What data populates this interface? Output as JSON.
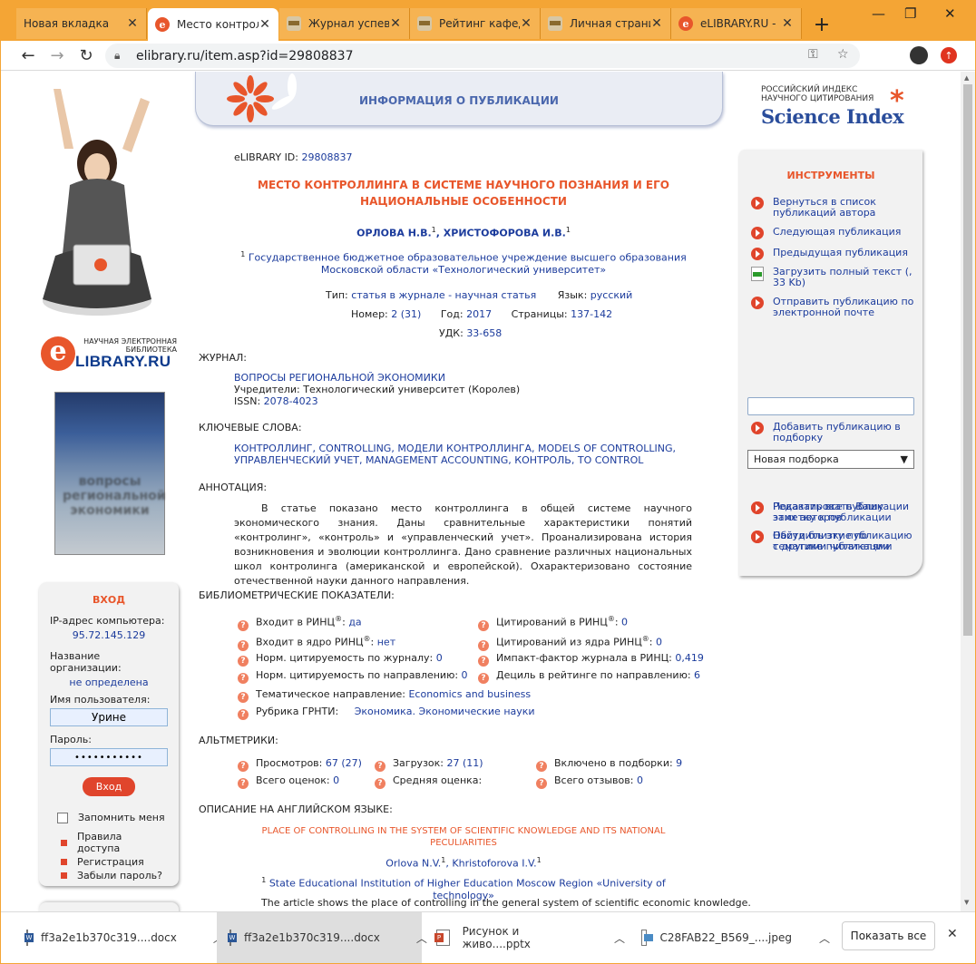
{
  "tabs": [
    {
      "title": "Новая вкладка",
      "favicon": "none"
    },
    {
      "title": "Место контрол",
      "favicon": "elibrary-e"
    },
    {
      "title": "Журнал успев",
      "favicon": "cap"
    },
    {
      "title": "Рейтинг кафед",
      "favicon": "cap"
    },
    {
      "title": "Личная страни",
      "favicon": "cap"
    },
    {
      "title": "eLIBRARY.RU -",
      "favicon": "elibrary-e"
    }
  ],
  "new_tab": "+",
  "address_bar": {
    "url": "elibrary.ru/item.asp?id=29808837"
  },
  "banner": {
    "title": "ИНФОРМАЦИЯ О ПУБЛИКАЦИИ"
  },
  "left": {
    "logo_caption": "НАУЧНАЯ ЭЛЕКТРОННАЯ БИБЛИОТЕКА",
    "logo_letter": "e",
    "logo_word": "LIBRARY.RU",
    "cover_text": "вопросы региональной экономики"
  },
  "login": {
    "title": "ВХОД",
    "ip_label": "IP-адрес компьютера:",
    "ip_value": "95.72.145.129",
    "org_label": "Название организации:",
    "org_value": "не определена",
    "user_label": "Имя пользователя:",
    "user_value": "Урине",
    "pass_label": "Пароль:",
    "pass_value": "•••••••••••",
    "submit": "Вход",
    "remember": "Запомнить меня",
    "links": [
      "Правила доступа",
      "Регистрация",
      "Забыли пароль?"
    ]
  },
  "science_index": {
    "line1": "РОССИЙСКИЙ ИНДЕКС",
    "line2": "НАУЧНОГО ЦИТИРОВАНИЯ",
    "brand": "Science Index"
  },
  "tools": {
    "title": "ИНСТРУМЕНТЫ",
    "items": [
      "Вернуться в список публикаций автора",
      "Следующая публикация",
      "Предыдущая публикация",
      "Загрузить полный текст (, 33 Kb)",
      "Отправить публикацию по электронной почте",
      "Добавить публикацию в подборку",
      "Редактировать Вашу заметку к публикации",
      "Обсудить эту публикацию с другими читателями",
      "Показать все публикации этих авторов",
      "Найти близкие по тематике публикации"
    ],
    "collection_select": "Новая подборка"
  },
  "publication": {
    "id_label": "eLIBRARY ID:",
    "id_value": "29808837",
    "title": "МЕСТО КОНТРОЛЛИНГА В СИСТЕМЕ НАУЧНОГО ПОЗНАНИЯ И ЕГО НАЦИОНАЛЬНЫЕ ОСОБЕННОСТИ",
    "author1": "ОРЛОВА Н.В.",
    "author2": "ХРИСТОФОРОВА И.В.",
    "affiliation": "Государственное бюджетное образовательное учреждение высшего образования Московской области «Технологический университет»",
    "type_label": "Тип:",
    "type_value": "статья в журнале - научная статья",
    "lang_label": "Язык:",
    "lang_value": "русский",
    "number_label": "Номер:",
    "number_value": "2 (31)",
    "year_label": "Год:",
    "year_value": "2017",
    "pages_label": "Страницы:",
    "pages_value": "137-142",
    "udk_label": "УДК:",
    "udk_value": "33-658"
  },
  "journal": {
    "heading": "ЖУРНАЛ:",
    "name": "ВОПРОСЫ РЕГИОНАЛЬНОЙ ЭКОНОМИКИ",
    "founders_label": "Учредители:",
    "founders_value": "Технологический университет (Королев)",
    "issn_label": "ISSN:",
    "issn_value": "2078-4023"
  },
  "keywords": {
    "heading": "КЛЮЧЕВЫЕ СЛОВА:",
    "line1": "КОНТРОЛЛИНГ, CONTROLLING, МОДЕЛИ КОНТРОЛЛИНГА, MODELS OF CONTROLLING,",
    "line2": "УПРАВЛЕНЧЕСКИЙ УЧЕТ, MANAGEMENT ACCOUNTING, КОНТРОЛЬ, TO CONTROL"
  },
  "annotation": {
    "heading": "АННОТАЦИЯ:",
    "text": "В статье показано место контроллинга в общей системе научного экономического знания. Даны сравнительные характеристики понятий «контролинг», «контроль» и «управленческий учет». Проанализирована история возникновения и эволюции контроллинга. Дано сравнение различных национальных школ контролинга (американской и европейской). Охарактеризовано состояние отечественной науки данного направления."
  },
  "bibliometrics": {
    "heading": "БИБЛИОМЕТРИЧЕСКИЕ ПОКАЗАТЕЛИ:",
    "rinc_in_label": "Входит в РИНЦ",
    "rinc_in_value": "да",
    "cit_rinc_label": "Цитирований в РИНЦ",
    "cit_rinc_value": "0",
    "core_label": "Входит в ядро РИНЦ",
    "core_value": "нет",
    "cit_core_label": "Цитирований из ядра РИНЦ",
    "cit_core_value": "0",
    "norm_journal_label": "Норм. цитируемость по журналу:",
    "norm_journal_value": "0",
    "impact_label": "Импакт-фактор журнала в РИНЦ:",
    "impact_value": "0,419",
    "norm_dir_label": "Норм. цитируемость по направлению:",
    "norm_dir_value": "0",
    "decile_label": "Дециль в рейтинге по направлению:",
    "decile_value": "6",
    "theme_label": "Тематическое направление:",
    "theme_value": "Economics and business",
    "grnti_label": "Рубрика ГРНТИ:",
    "grnti_value": "Экономика. Экономические науки"
  },
  "altmetrics": {
    "heading": "АЛЬТМЕТРИКИ:",
    "views_label": "Просмотров:",
    "views_value": "67 (27)",
    "downloads_label": "Загрузок:",
    "downloads_value": "27 (11)",
    "collections_label": "Включено в подборки:",
    "collections_value": "9",
    "ratings_label": "Всего оценок:",
    "ratings_value": "0",
    "avg_label": "Средняя оценка:",
    "reviews_label": "Всего отзывов:",
    "reviews_value": "0"
  },
  "english": {
    "heading": "ОПИСАНИЕ НА АНГЛИЙСКОМ ЯЗЫКЕ:",
    "title": "PLACE OF CONTROLLING IN THE SYSTEM OF SCIENTIFIC KNOWLEDGE AND ITS NATIONAL PECULIARITIES",
    "author1": "Orlova N.V.",
    "author2": "Khristoforova I.V.",
    "affiliation": "State Educational Institution of Higher Education Moscow Region «University of technology»",
    "abstract_start": "The article shows the place of controlling in the general system of scientific economic knowledge."
  },
  "downloads": [
    {
      "name": "ff3a2e1b370c319....docx",
      "kind": "word"
    },
    {
      "name": "ff3a2e1b370c319....docx",
      "kind": "word"
    },
    {
      "name": "Рисунок и живо....pptx",
      "kind": "ppt"
    },
    {
      "name": "C28FAB22_B569_....jpeg",
      "kind": "img"
    }
  ],
  "show_all": "Показать все",
  "colors": {
    "accent": "#e8562b",
    "link": "#1b3b9c",
    "chrome": "#f4a535"
  }
}
